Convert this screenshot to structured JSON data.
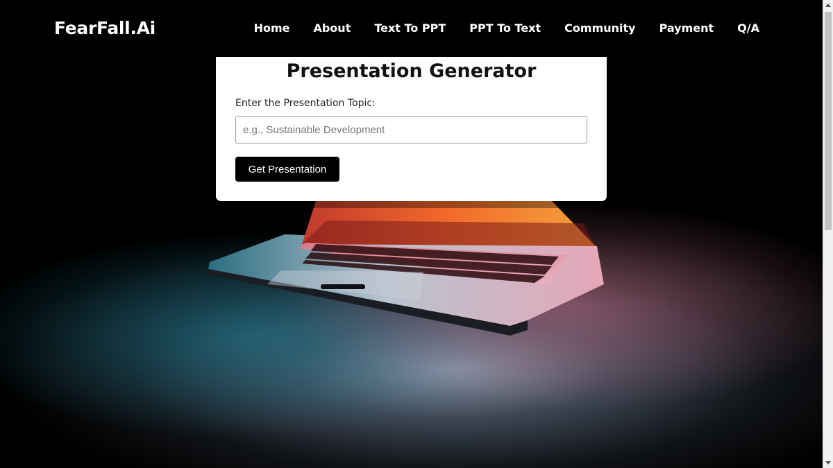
{
  "brand": {
    "name": "FearFall.Ai"
  },
  "nav": {
    "items": [
      {
        "label": "Home"
      },
      {
        "label": "About"
      },
      {
        "label": "Text To PPT"
      },
      {
        "label": "PPT To Text"
      },
      {
        "label": "Community"
      },
      {
        "label": "Payment"
      },
      {
        "label": "Q/A"
      }
    ]
  },
  "generator": {
    "title": "Presentation Generator",
    "topic_label": "Enter the Presentation Topic:",
    "topic_value": "",
    "topic_placeholder": "e.g., Sustainable Development",
    "submit_label": "Get Presentation"
  },
  "hero": {
    "image": "laptop-glowing-screen-photo"
  },
  "colors": {
    "background": "#000000",
    "card": "#ffffff",
    "button": "#000000",
    "text_light": "#ffffff"
  }
}
